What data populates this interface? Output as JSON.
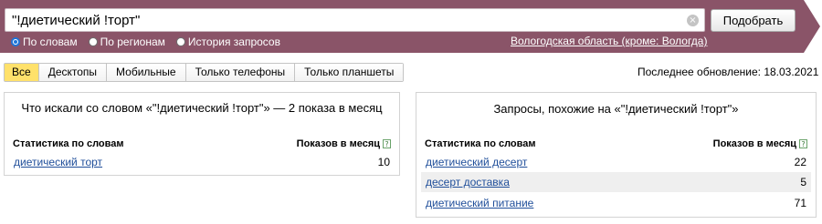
{
  "search": {
    "query": "\"!диетический !торт\"",
    "submit_label": "Подобрать",
    "clear_symbol": "×"
  },
  "modes": [
    {
      "label": "По словам",
      "checked": true
    },
    {
      "label": "По регионам",
      "checked": false
    },
    {
      "label": "История запросов",
      "checked": false
    }
  ],
  "region_link": "Вологодская область (кроме: Вологда)",
  "tabs": [
    "Все",
    "Десктопы",
    "Мобильные",
    "Только телефоны",
    "Только планшеты"
  ],
  "active_tab": "Все",
  "last_update": "Последнее обновление: 18.03.2021",
  "left_panel": {
    "title": "Что искали со словом «\"!диетический !торт\"» — 2 показа в месяц",
    "col_word": "Статистика по словам",
    "col_count": "Показов в месяц",
    "help_symbol": "?",
    "rows": [
      {
        "phrase": "диетический торт",
        "count": "10"
      }
    ]
  },
  "right_panel": {
    "title": "Запросы, похожие на «\"!диетический !торт\"»",
    "col_word": "Статистика по словам",
    "col_count": "Показов в месяц",
    "help_symbol": "?",
    "rows": [
      {
        "phrase": "диетический десерт",
        "count": "22"
      },
      {
        "phrase": "десерт доставка",
        "count": "5"
      },
      {
        "phrase": "диетический питание",
        "count": "71"
      }
    ]
  },
  "colors": {
    "header_band": "#8a5468",
    "active_tab": "#ffe16b",
    "link": "#1f4e9a",
    "radio_checked": "#1e74d8"
  }
}
